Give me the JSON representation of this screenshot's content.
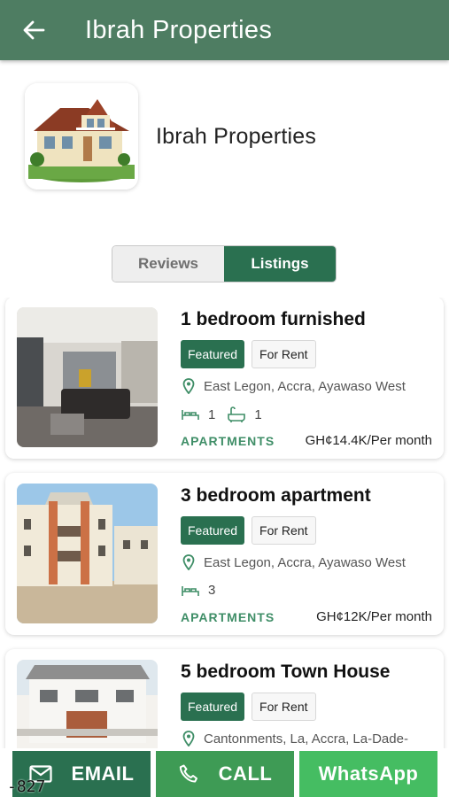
{
  "header": {
    "title": "Ibrah Properties",
    "back_icon": "arrow-left-icon",
    "color": "#4e7d62"
  },
  "agency": {
    "name": "Ibrah Properties",
    "logo": "house-logo-image"
  },
  "tabs": [
    {
      "label": "Reviews",
      "active": false
    },
    {
      "label": "Listings",
      "active": true
    }
  ],
  "listings": [
    {
      "title": "1 bedroom furnished",
      "badges": [
        "Featured",
        "For Rent"
      ],
      "location": "East Legon, Accra, Ayawaso West",
      "beds": "1",
      "baths": "1",
      "category": "APARTMENTS",
      "price": "GH¢14.4K/Per month",
      "image": "living-room-photo"
    },
    {
      "title": "3 bedroom apartment",
      "badges": [
        "Featured",
        "For Rent"
      ],
      "location": "East Legon, Accra, Ayawaso West",
      "beds": "3",
      "category": "APARTMENTS",
      "price": "GH¢12K/Per month",
      "image": "apartment-building-photo"
    },
    {
      "title": "5 bedroom Town House",
      "badges": [
        "Featured",
        "For Rent"
      ],
      "location": "Cantonments, La, Accra, La-Dade-",
      "image": "townhouse-photo"
    }
  ],
  "actions": {
    "email": "EMAIL",
    "call": "CALL",
    "whatsapp": "WhatsApp"
  },
  "colors": {
    "primary": "#2a7050",
    "call": "#3e9b55",
    "whatsapp": "#45bd62",
    "category": "#3f8e67"
  },
  "overlay": {
    "number": "-827"
  }
}
